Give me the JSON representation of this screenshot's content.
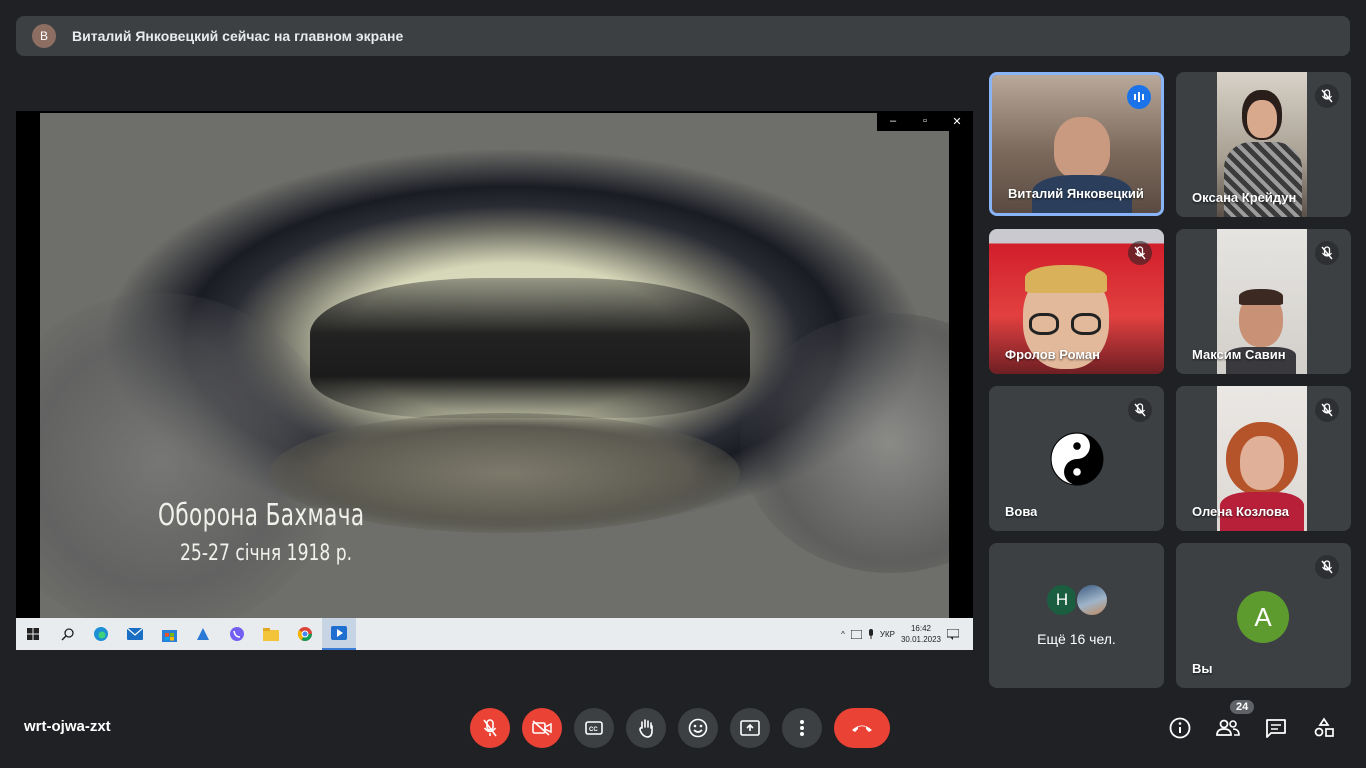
{
  "banner": {
    "avatar_letter": "В",
    "text": "Виталий Янковецкий сейчас на главном экране"
  },
  "presentation": {
    "caption_title": "Оборона Бахмача",
    "caption_date": "25-27 січня 1918 р.",
    "window_controls": [
      "–",
      "▫",
      "✕"
    ]
  },
  "taskbar": {
    "apps": [
      "start",
      "search",
      "edge",
      "mail",
      "store",
      "azure",
      "viber",
      "explorer",
      "chrome",
      "player"
    ],
    "tray": {
      "lang": "УКР",
      "time": "16:42",
      "date": "30.01.2023"
    }
  },
  "tiles": [
    {
      "name": "Виталий Янковецкий",
      "status": "speaking"
    },
    {
      "name": "Оксана Крейдун",
      "status": "muted"
    },
    {
      "name": "Фролов Роман",
      "status": "muted"
    },
    {
      "name": "Максим Савин",
      "status": "muted"
    },
    {
      "name": "Вова",
      "status": "muted"
    },
    {
      "name": "Олена Козлова",
      "status": "muted"
    },
    {
      "name": "",
      "more_label": "Ещё 16 чел.",
      "avatar_letter": "Н"
    },
    {
      "name": "Вы",
      "avatar_letter": "А",
      "status": "muted"
    }
  ],
  "bottom": {
    "meeting_code": "wrt-ojwa-zxt",
    "participants_count": "24"
  },
  "colors": {
    "red": "#ea4335",
    "tile": "#3c4043",
    "bg": "#202124",
    "accent": "#8ab4f8"
  }
}
